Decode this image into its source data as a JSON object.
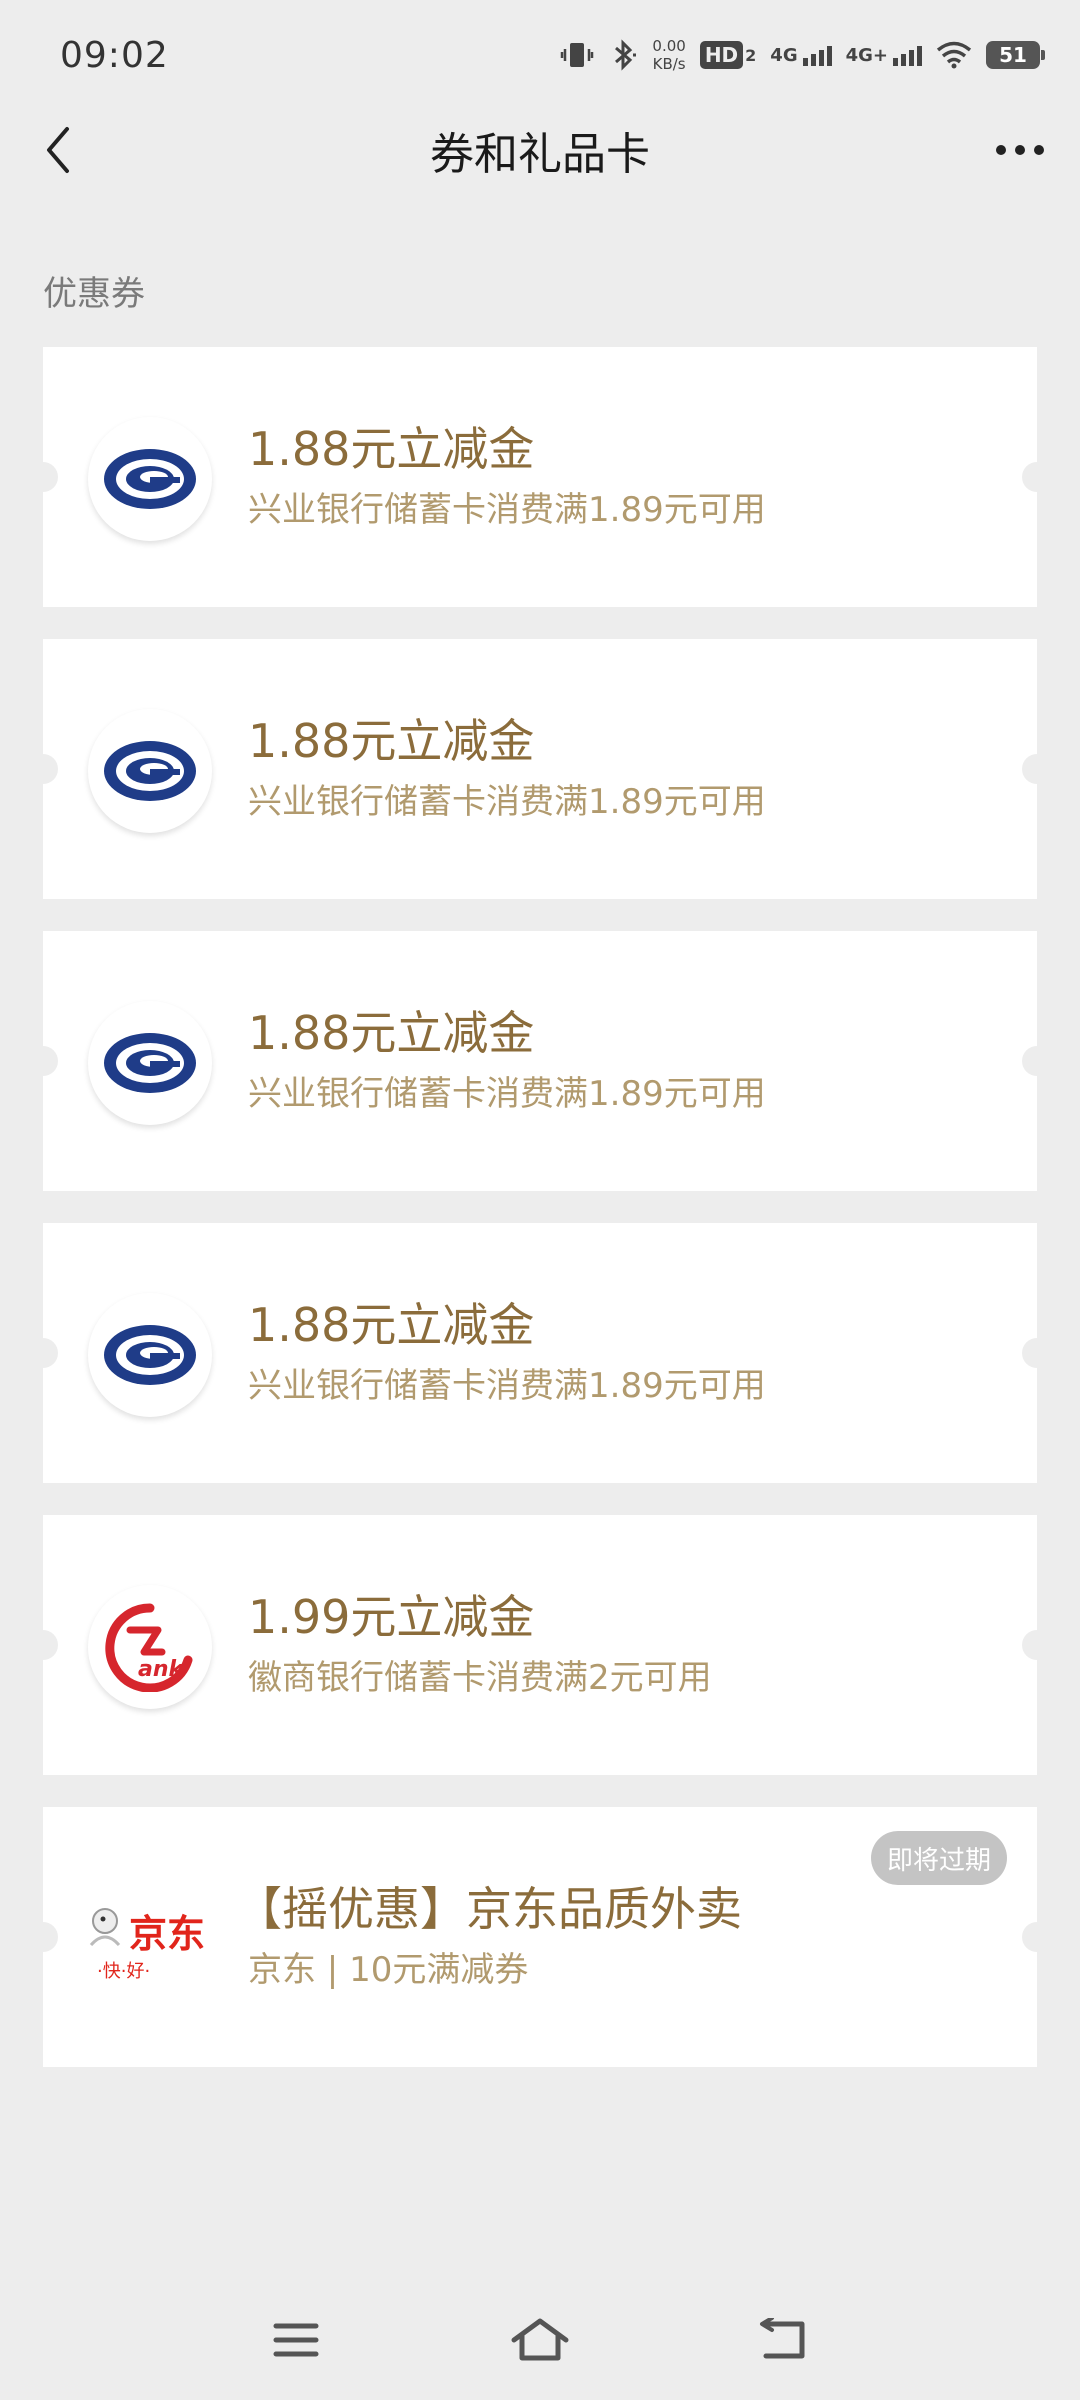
{
  "status_bar": {
    "time": "09:02",
    "net_speed_value": "0.00",
    "net_speed_unit": "KB/s",
    "hd_label": "HD",
    "hd_sub": "2",
    "net1_label": "4G",
    "net2_label": "4G+",
    "battery_level": "51"
  },
  "header": {
    "title": "券和礼品卡"
  },
  "section": {
    "label": "优惠券"
  },
  "coupons": [
    {
      "title": "1.88元立减金",
      "desc": "兴业银行储蓄卡消费满1.89元可用",
      "logo": "cib-bank-logo-icon"
    },
    {
      "title": "1.88元立减金",
      "desc": "兴业银行储蓄卡消费满1.89元可用",
      "logo": "cib-bank-logo-icon"
    },
    {
      "title": "1.88元立减金",
      "desc": "兴业银行储蓄卡消费满1.89元可用",
      "logo": "cib-bank-logo-icon"
    },
    {
      "title": "1.88元立减金",
      "desc": "兴业银行储蓄卡消费满1.89元可用",
      "logo": "cib-bank-logo-icon"
    },
    {
      "title": "1.99元立减金",
      "desc": "徽商银行储蓄卡消费满2元可用",
      "logo": "huishang-bank-logo-icon"
    },
    {
      "title": "【摇优惠】京东品质外卖",
      "desc": "京东 | 10元满减券",
      "logo": "jd-logo-icon",
      "badge": "即将过期"
    }
  ],
  "jd_logo": {
    "brand": "京东",
    "slogan": "·快·好·"
  },
  "colors": {
    "background": "#ededed",
    "coupon_title": "#8b6c3b",
    "coupon_desc": "#b19a6e",
    "cib_blue": "#1f3c88",
    "huishang_red": "#d6262d",
    "jd_red": "#e1251b",
    "badge_bg": "#c4c4c4"
  }
}
